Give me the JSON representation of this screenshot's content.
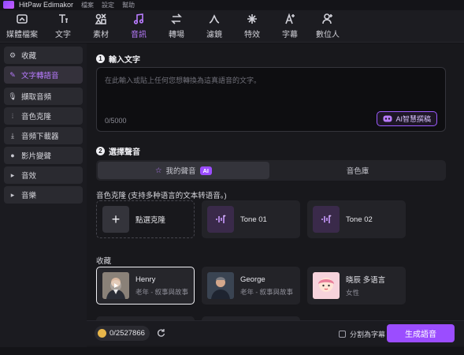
{
  "titlebar": {
    "app": "HitPaw Edimakor",
    "menu": [
      "檔案",
      "設定",
      "幫助"
    ]
  },
  "toolbar": [
    {
      "label": "媒體檔案",
      "icon": "media-icon"
    },
    {
      "label": "文字",
      "icon": "text-icon"
    },
    {
      "label": "素材",
      "icon": "assets-icon"
    },
    {
      "label": "音訊",
      "icon": "music-note-icon",
      "active": true
    },
    {
      "label": "轉場",
      "icon": "transition-icon"
    },
    {
      "label": "濾鏡",
      "icon": "filter-icon"
    },
    {
      "label": "特效",
      "icon": "effects-icon"
    },
    {
      "label": "字幕",
      "icon": "subtitle-icon"
    },
    {
      "label": "數位人",
      "icon": "avatar-person-icon"
    }
  ],
  "sidebar": [
    {
      "label": "收藏",
      "icon": "gear-icon"
    },
    {
      "label": "文字轉語音",
      "icon": "tts-icon",
      "active": true
    },
    {
      "label": "擷取音頻",
      "icon": "mic-icon"
    },
    {
      "label": "音色克隆",
      "icon": "waveform-icon"
    },
    {
      "label": "音頻下載器",
      "icon": "download-icon"
    },
    {
      "label": "影片變聲",
      "icon": "voice-changer-icon"
    },
    {
      "label": "音效",
      "icon": "chevron-right-icon"
    },
    {
      "label": "音樂",
      "icon": "chevron-right-icon"
    }
  ],
  "input_section": {
    "number": "1",
    "title": "輸入文字",
    "placeholder": "在此輸入或貼上任何您想轉換為這真語音的文字。",
    "count": "0/5000",
    "ai_button": "AI智慧撰稿"
  },
  "voice_section": {
    "number": "2",
    "title": "選擇聲音",
    "tab_mine": "我的聲音",
    "tab_mine_badge": "AI",
    "tab_library": "音色庫",
    "clone_title": "音色克隆 (支持多种语言的文本转语音。)",
    "clone_cards": [
      {
        "label": "點選克隆",
        "kind": "add"
      },
      {
        "label": "Tone 01",
        "kind": "tone"
      },
      {
        "label": "Tone 02",
        "kind": "tone"
      }
    ],
    "fav_title": "收藏",
    "fav_cards": [
      {
        "name": "Henry",
        "sub": "老年 - 叙事與故事",
        "selected": true
      },
      {
        "name": "George",
        "sub": "老年 - 叙事與故事"
      },
      {
        "name": "晓辰 多语言",
        "sub": "女性"
      }
    ]
  },
  "bottom": {
    "credits": "0/2527866",
    "split_label": "分割為字幕",
    "generate": "生成語音"
  },
  "colors": {
    "accent": "#9b4dff",
    "bg": "#18181c",
    "card": "#232328"
  }
}
